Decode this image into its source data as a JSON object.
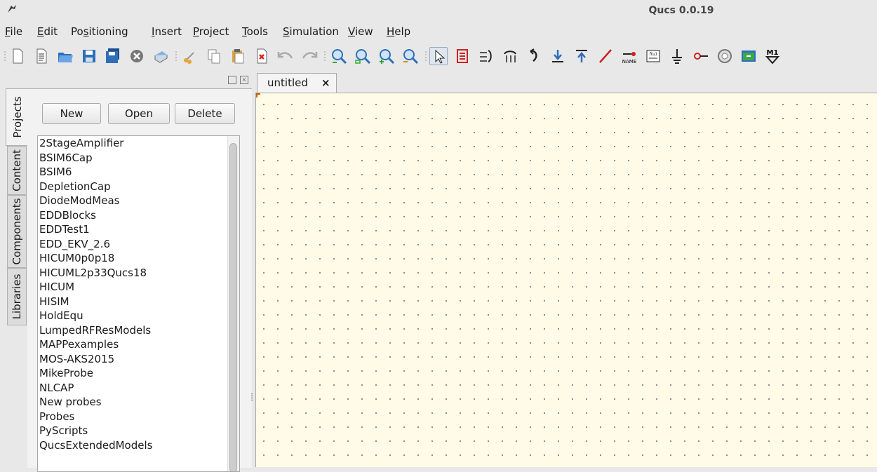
{
  "window": {
    "title": "Qucs 0.0.19"
  },
  "menu": [
    {
      "label": "File",
      "key": "F",
      "rest": "ile"
    },
    {
      "label": "Edit",
      "key": "E",
      "rest": "dit"
    },
    {
      "label": "Positioning",
      "pre": "Po",
      "key": "s",
      "rest": "itioning"
    },
    {
      "label": "Insert",
      "key": "I",
      "rest": "nsert"
    },
    {
      "label": "Project",
      "key": "P",
      "rest": "roject"
    },
    {
      "label": "Tools",
      "key": "T",
      "rest": "ools"
    },
    {
      "label": "Simulation",
      "key": "S",
      "rest": "imulation"
    },
    {
      "label": "View",
      "key": "V",
      "rest": "iew"
    },
    {
      "label": "Help",
      "key": "H",
      "rest": "elp"
    }
  ],
  "toolbar": {
    "icons": [
      "new-document-icon",
      "new-text-icon",
      "open-icon",
      "save-icon",
      "save-all-icon",
      "close-icon",
      "print-icon",
      "cut-icon",
      "copy-icon",
      "paste-icon",
      "delete-icon",
      "undo-icon",
      "redo-icon",
      "zoom-fit-icon",
      "zoom-selection-icon",
      "zoom-in-icon",
      "zoom-out-icon",
      "select-icon",
      "deactivate-icon",
      "mirror-x-icon",
      "mirror-y-icon",
      "rotate-icon",
      "go-into-subcircuit-icon",
      "pop-out-icon",
      "wire-icon",
      "wire-label-icon",
      "equation-icon",
      "ground-icon",
      "port-icon",
      "simulate-icon",
      "dc-bias-icon",
      "marker-icon"
    ],
    "name_label": "NAME",
    "equation_label": "f(u)",
    "marker_label": "M1"
  },
  "dock": {
    "tabs": [
      "Projects",
      "Content",
      "Components",
      "Libraries"
    ],
    "buttons": {
      "new": "New",
      "open": "Open",
      "delete": "Delete"
    },
    "projects": [
      "2StageAmplifier",
      "BSIM6Cap",
      "BSIM6",
      "DepletionCap",
      "DiodeModMeas",
      "EDDBlocks",
      "EDDTest1",
      "EDD_EKV_2.6",
      "HICUM0p0p18",
      "HICUML2p33Qucs18",
      "HICUM",
      "HISIM",
      "HoldEqu",
      "LumpedRFResModels",
      "MAPPexamples",
      "MOS-AKS2015",
      "MikeProbe",
      "NLCAP",
      "New probes",
      "Probes",
      "PyScripts",
      "QucsExtendedModels"
    ]
  },
  "editor": {
    "tab_label": "untitled",
    "tab_close": "×",
    "canvas_color": "#fffbe7"
  }
}
